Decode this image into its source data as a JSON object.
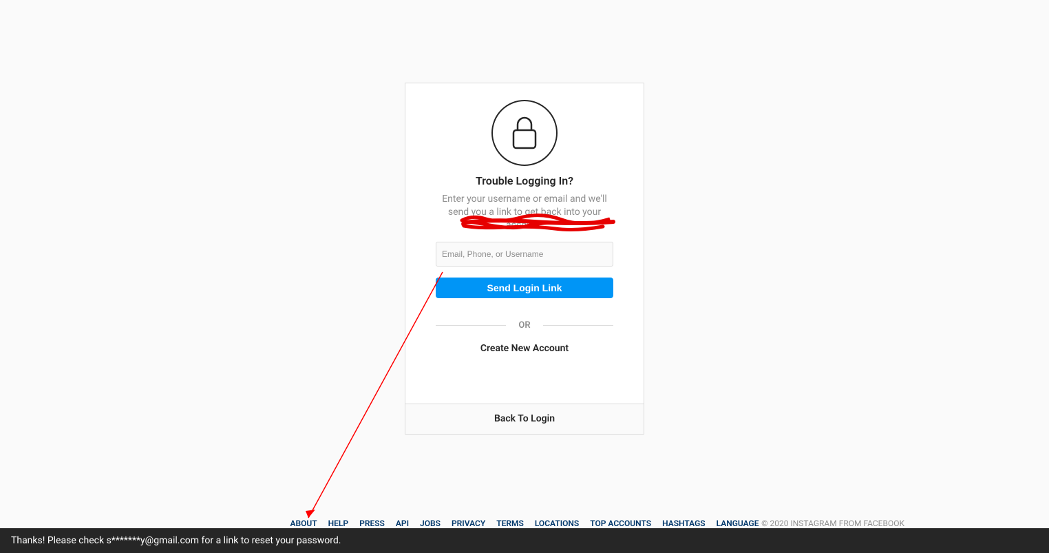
{
  "card": {
    "title": "Trouble Logging In?",
    "subtitle": "Enter your username or email and we'll send you a link to get back into your account.",
    "input_placeholder": "Email, Phone, or Username",
    "send_button": "Send Login Link",
    "divider": "OR",
    "create_account": "Create New Account",
    "back_to_login": "Back To Login"
  },
  "footer": {
    "links": {
      "about": "ABOUT",
      "help": "HELP",
      "press": "PRESS",
      "api": "API",
      "jobs": "JOBS",
      "privacy": "PRIVACY",
      "terms": "TERMS",
      "locations": "LOCATIONS",
      "top_accounts": "TOP ACCOUNTS",
      "hashtags": "HASHTAGS",
      "language": "LANGUAGE"
    },
    "copyright": "© 2020 INSTAGRAM FROM FACEBOOK"
  },
  "toast": {
    "message": "Thanks! Please check s*******y@gmail.com for a link to reset your password."
  }
}
